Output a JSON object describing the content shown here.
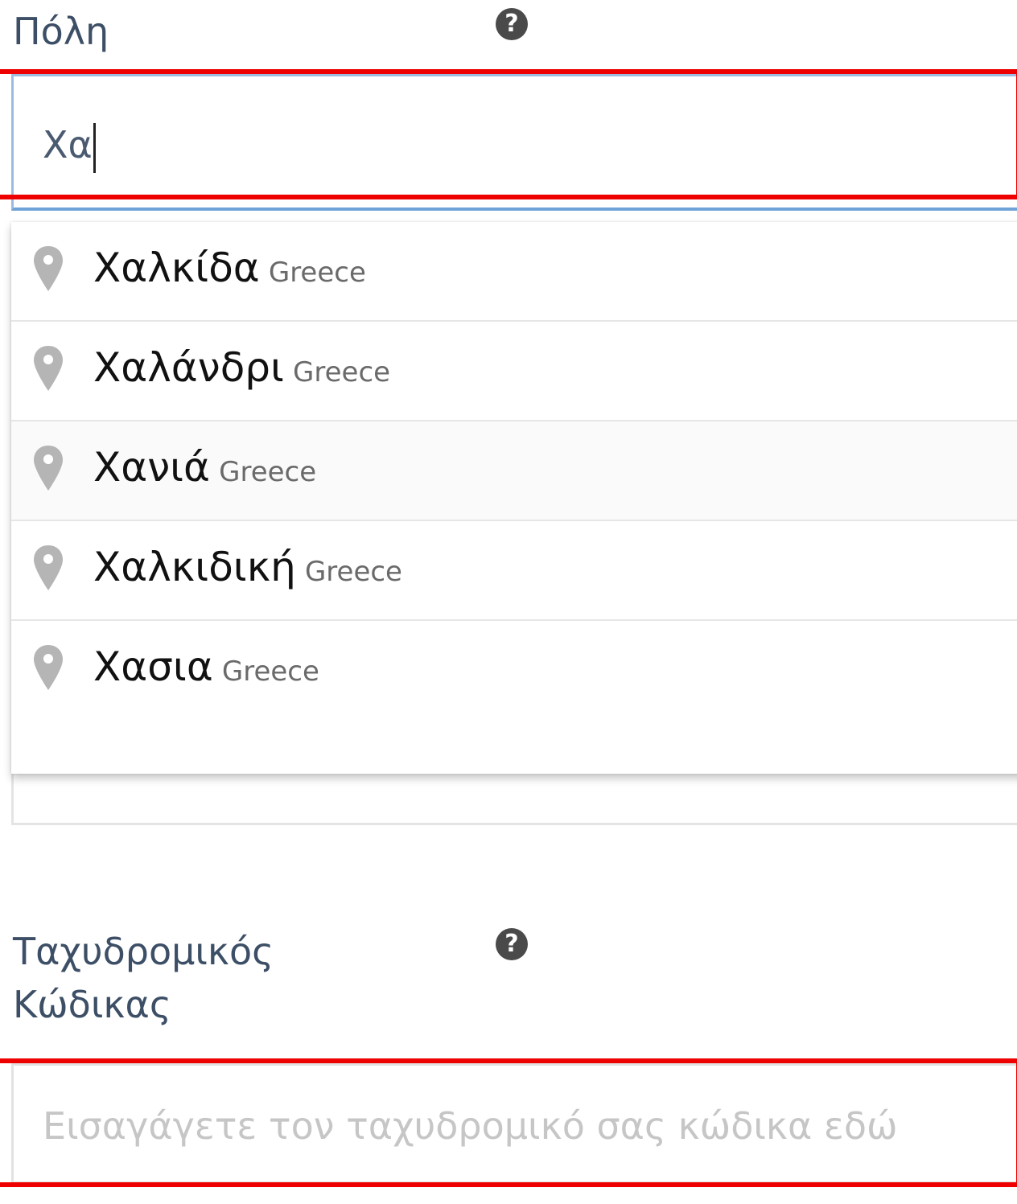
{
  "city_field": {
    "label": "Πόλη",
    "help_icon": "question-mark-icon",
    "typed_value": "Χα"
  },
  "suggestions": [
    {
      "name": "Χαλκίδα",
      "country": "Greece",
      "icon": "map-pin-icon"
    },
    {
      "name": "Χαλάνδρι",
      "country": "Greece",
      "icon": "map-pin-icon"
    },
    {
      "name": "Χανιά",
      "country": "Greece",
      "icon": "map-pin-icon"
    },
    {
      "name": "Χαλκιδική",
      "country": "Greece",
      "icon": "map-pin-icon"
    },
    {
      "name": "Χασια",
      "country": "Greece",
      "icon": "map-pin-icon"
    }
  ],
  "postal_field": {
    "label_line1": "Ταχυδρομικός",
    "label_line2": "Κώδικας",
    "help_icon": "question-mark-icon",
    "placeholder": "Εισαγάγετε τον ταχυδρομικό σας κώδικα εδώ"
  },
  "colors": {
    "highlight_outline": "#ee0000",
    "focus_border": "#6fa3d8",
    "label": "#3d4f66"
  }
}
